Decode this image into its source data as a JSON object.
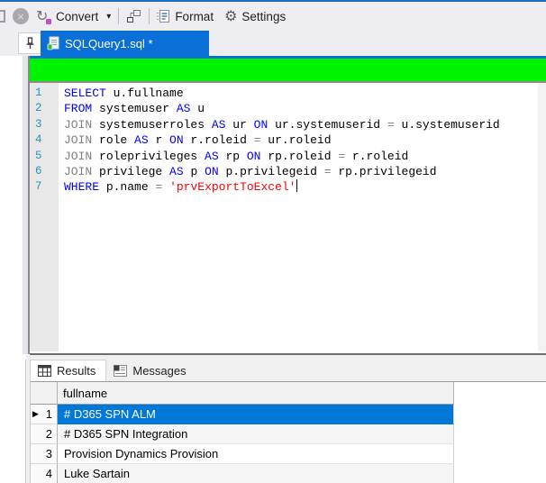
{
  "toolbar": {
    "convert": {
      "label": "Convert",
      "caret_glyph": "▾",
      "icon_glyph": "↻"
    },
    "format": {
      "label": "Format"
    },
    "settings": {
      "label": "Settings",
      "gear_glyph": "⚙"
    },
    "disabled_button_glyph": "×"
  },
  "file_tab": {
    "label": "SQLQuery1.sql *"
  },
  "editor": {
    "line_numbers": [
      "1",
      "2",
      "3",
      "4",
      "5",
      "6",
      "7"
    ],
    "lines": [
      [
        {
          "c": "kw",
          "t": "SELECT"
        },
        {
          "c": "id",
          "t": " u.fullname"
        }
      ],
      [
        {
          "c": "kw",
          "t": "FROM"
        },
        {
          "c": "id",
          "t": " systemuser "
        },
        {
          "c": "kw",
          "t": "AS"
        },
        {
          "c": "id",
          "t": " u"
        }
      ],
      [
        {
          "c": "gr",
          "t": "JOIN"
        },
        {
          "c": "id",
          "t": " systemuserroles "
        },
        {
          "c": "kw",
          "t": "AS"
        },
        {
          "c": "id",
          "t": " ur "
        },
        {
          "c": "kw",
          "t": "ON"
        },
        {
          "c": "id",
          "t": " ur.systemuserid "
        },
        {
          "c": "gr",
          "t": "="
        },
        {
          "c": "id",
          "t": " u.systemuserid"
        }
      ],
      [
        {
          "c": "gr",
          "t": "JOIN"
        },
        {
          "c": "id",
          "t": " role "
        },
        {
          "c": "kw",
          "t": "AS"
        },
        {
          "c": "id",
          "t": " r "
        },
        {
          "c": "kw",
          "t": "ON"
        },
        {
          "c": "id",
          "t": " r.roleid "
        },
        {
          "c": "gr",
          "t": "="
        },
        {
          "c": "id",
          "t": " ur.roleid"
        }
      ],
      [
        {
          "c": "gr",
          "t": "JOIN"
        },
        {
          "c": "id",
          "t": " roleprivileges "
        },
        {
          "c": "kw",
          "t": "AS"
        },
        {
          "c": "id",
          "t": " rp "
        },
        {
          "c": "kw",
          "t": "ON"
        },
        {
          "c": "id",
          "t": " rp.roleid "
        },
        {
          "c": "gr",
          "t": "="
        },
        {
          "c": "id",
          "t": " r.roleid"
        }
      ],
      [
        {
          "c": "gr",
          "t": "JOIN"
        },
        {
          "c": "id",
          "t": " privilege "
        },
        {
          "c": "kw",
          "t": "AS"
        },
        {
          "c": "id",
          "t": " p "
        },
        {
          "c": "kw",
          "t": "ON"
        },
        {
          "c": "id",
          "t": " p.privilegeid "
        },
        {
          "c": "gr",
          "t": "="
        },
        {
          "c": "id",
          "t": " rp.privilegeid"
        }
      ],
      [
        {
          "c": "kw",
          "t": "WHERE"
        },
        {
          "c": "id",
          "t": " p.name "
        },
        {
          "c": "gr",
          "t": "="
        },
        {
          "c": "id",
          "t": " "
        },
        {
          "c": "st",
          "t": "'prvExportToExcel'"
        },
        {
          "c": "cur",
          "t": ""
        }
      ]
    ]
  },
  "results": {
    "tabs": [
      {
        "label": "Results"
      },
      {
        "label": "Messages"
      }
    ],
    "column_header": "fullname",
    "row_pointer_glyph": "▶",
    "rows": [
      {
        "num": "1",
        "value": "# D365 SPN ALM"
      },
      {
        "num": "2",
        "value": "# D365 SPN Integration"
      },
      {
        "num": "3",
        "value": "Provision Dynamics Provision"
      },
      {
        "num": "4",
        "value": "Luke Sartain"
      }
    ]
  },
  "colors": {
    "accent_blue": "#0b6fd8",
    "status_green": "#00f400",
    "selection_blue": "#0078d7",
    "keyword_blue": "#0000ff",
    "operator_gray": "#808080",
    "string_red": "#ff0000",
    "line_number_teal": "#2b91af"
  }
}
